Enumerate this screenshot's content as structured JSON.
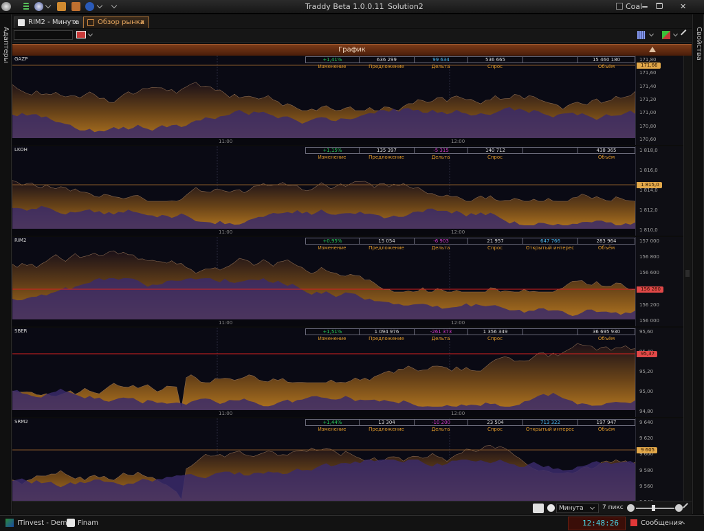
{
  "window": {
    "app_title": "Traddy Beta 1.0.0.11",
    "solution": "Solution2",
    "theme": "Coal",
    "controls": [
      "minimize",
      "maximize",
      "close"
    ]
  },
  "left_panel_label": "Адаптеры",
  "right_panel_label": "Свойства",
  "tabs": [
    {
      "label": "RIM2 - Минута",
      "close": "x"
    },
    {
      "label": "Обзор рынка",
      "close": "x",
      "active": true
    }
  ],
  "panel_title": "График",
  "stat_labels": {
    "change": "Изменение",
    "offer": "Предложение",
    "delta": "Дельта",
    "bid": "Спрос",
    "oi": "Открытый интерес",
    "volume": "Объём"
  },
  "time_labels": [
    "11:00",
    "12:00"
  ],
  "panes": [
    {
      "symbol": "GAZP",
      "change": "+1,41%",
      "offer": "636 299",
      "delta": "99 634",
      "bid": "536 665",
      "oi": "",
      "volume": "15 460 180",
      "yticks": [
        "171,80",
        "171,60",
        "171,40",
        "171,20",
        "171,00",
        "170,80",
        "170,60"
      ],
      "price": "171,66",
      "price_color": "#e2a84a",
      "line_color": "#8a5a2a",
      "delta_class": "blu"
    },
    {
      "symbol": "LKOH",
      "change": "+1,15%",
      "offer": "135 397",
      "delta": "-5 315",
      "bid": "140 712",
      "oi": "",
      "volume": "438 365",
      "yticks": [
        "1 818,0",
        "1 816,0",
        "1 814,0",
        "1 812,0",
        "1 810,0"
      ],
      "price": "1 815,0",
      "price_color": "#e2a84a",
      "line_color": "#8a5a2a",
      "delta_class": "neg"
    },
    {
      "symbol": "RIM2",
      "change": "+0,95%",
      "offer": "15 054",
      "delta": "-6 903",
      "bid": "21 957",
      "oi": "647 766",
      "volume": "283 964",
      "yticks": [
        "157 000",
        "156 800",
        "156 600",
        "156 400",
        "156 200",
        "156 000"
      ],
      "price": "156 280",
      "price_color": "#e04848",
      "line_color": "#d82020",
      "delta_class": "neg"
    },
    {
      "symbol": "SBER",
      "change": "+1,51%",
      "offer": "1 094 976",
      "delta": "-261 373",
      "bid": "1 356 349",
      "oi": "",
      "volume": "36 695 930",
      "yticks": [
        "95,60",
        "95,40",
        "95,20",
        "95,00",
        "94,80"
      ],
      "price": "95,37",
      "price_color": "#e04848",
      "line_color": "#d82020",
      "delta_class": "neg"
    },
    {
      "symbol": "SRM2",
      "change": "+1,44%",
      "offer": "13 304",
      "delta": "-10 200",
      "bid": "23 504",
      "oi": "713 322",
      "volume": "197 947",
      "yticks": [
        "9 640",
        "9 620",
        "9 600",
        "9 580",
        "9 560",
        "9 540"
      ],
      "price": "9 605",
      "price_color": "#e2a84a",
      "line_color": "#8a5a2a",
      "delta_class": "neg"
    }
  ],
  "bottom": {
    "timeframe": "Минута",
    "pixels": "7 пикс"
  },
  "status": {
    "account": "ITinvest - Demo",
    "broker": "Finam",
    "clock": "12:48:26",
    "messages": "Сообщения"
  }
}
